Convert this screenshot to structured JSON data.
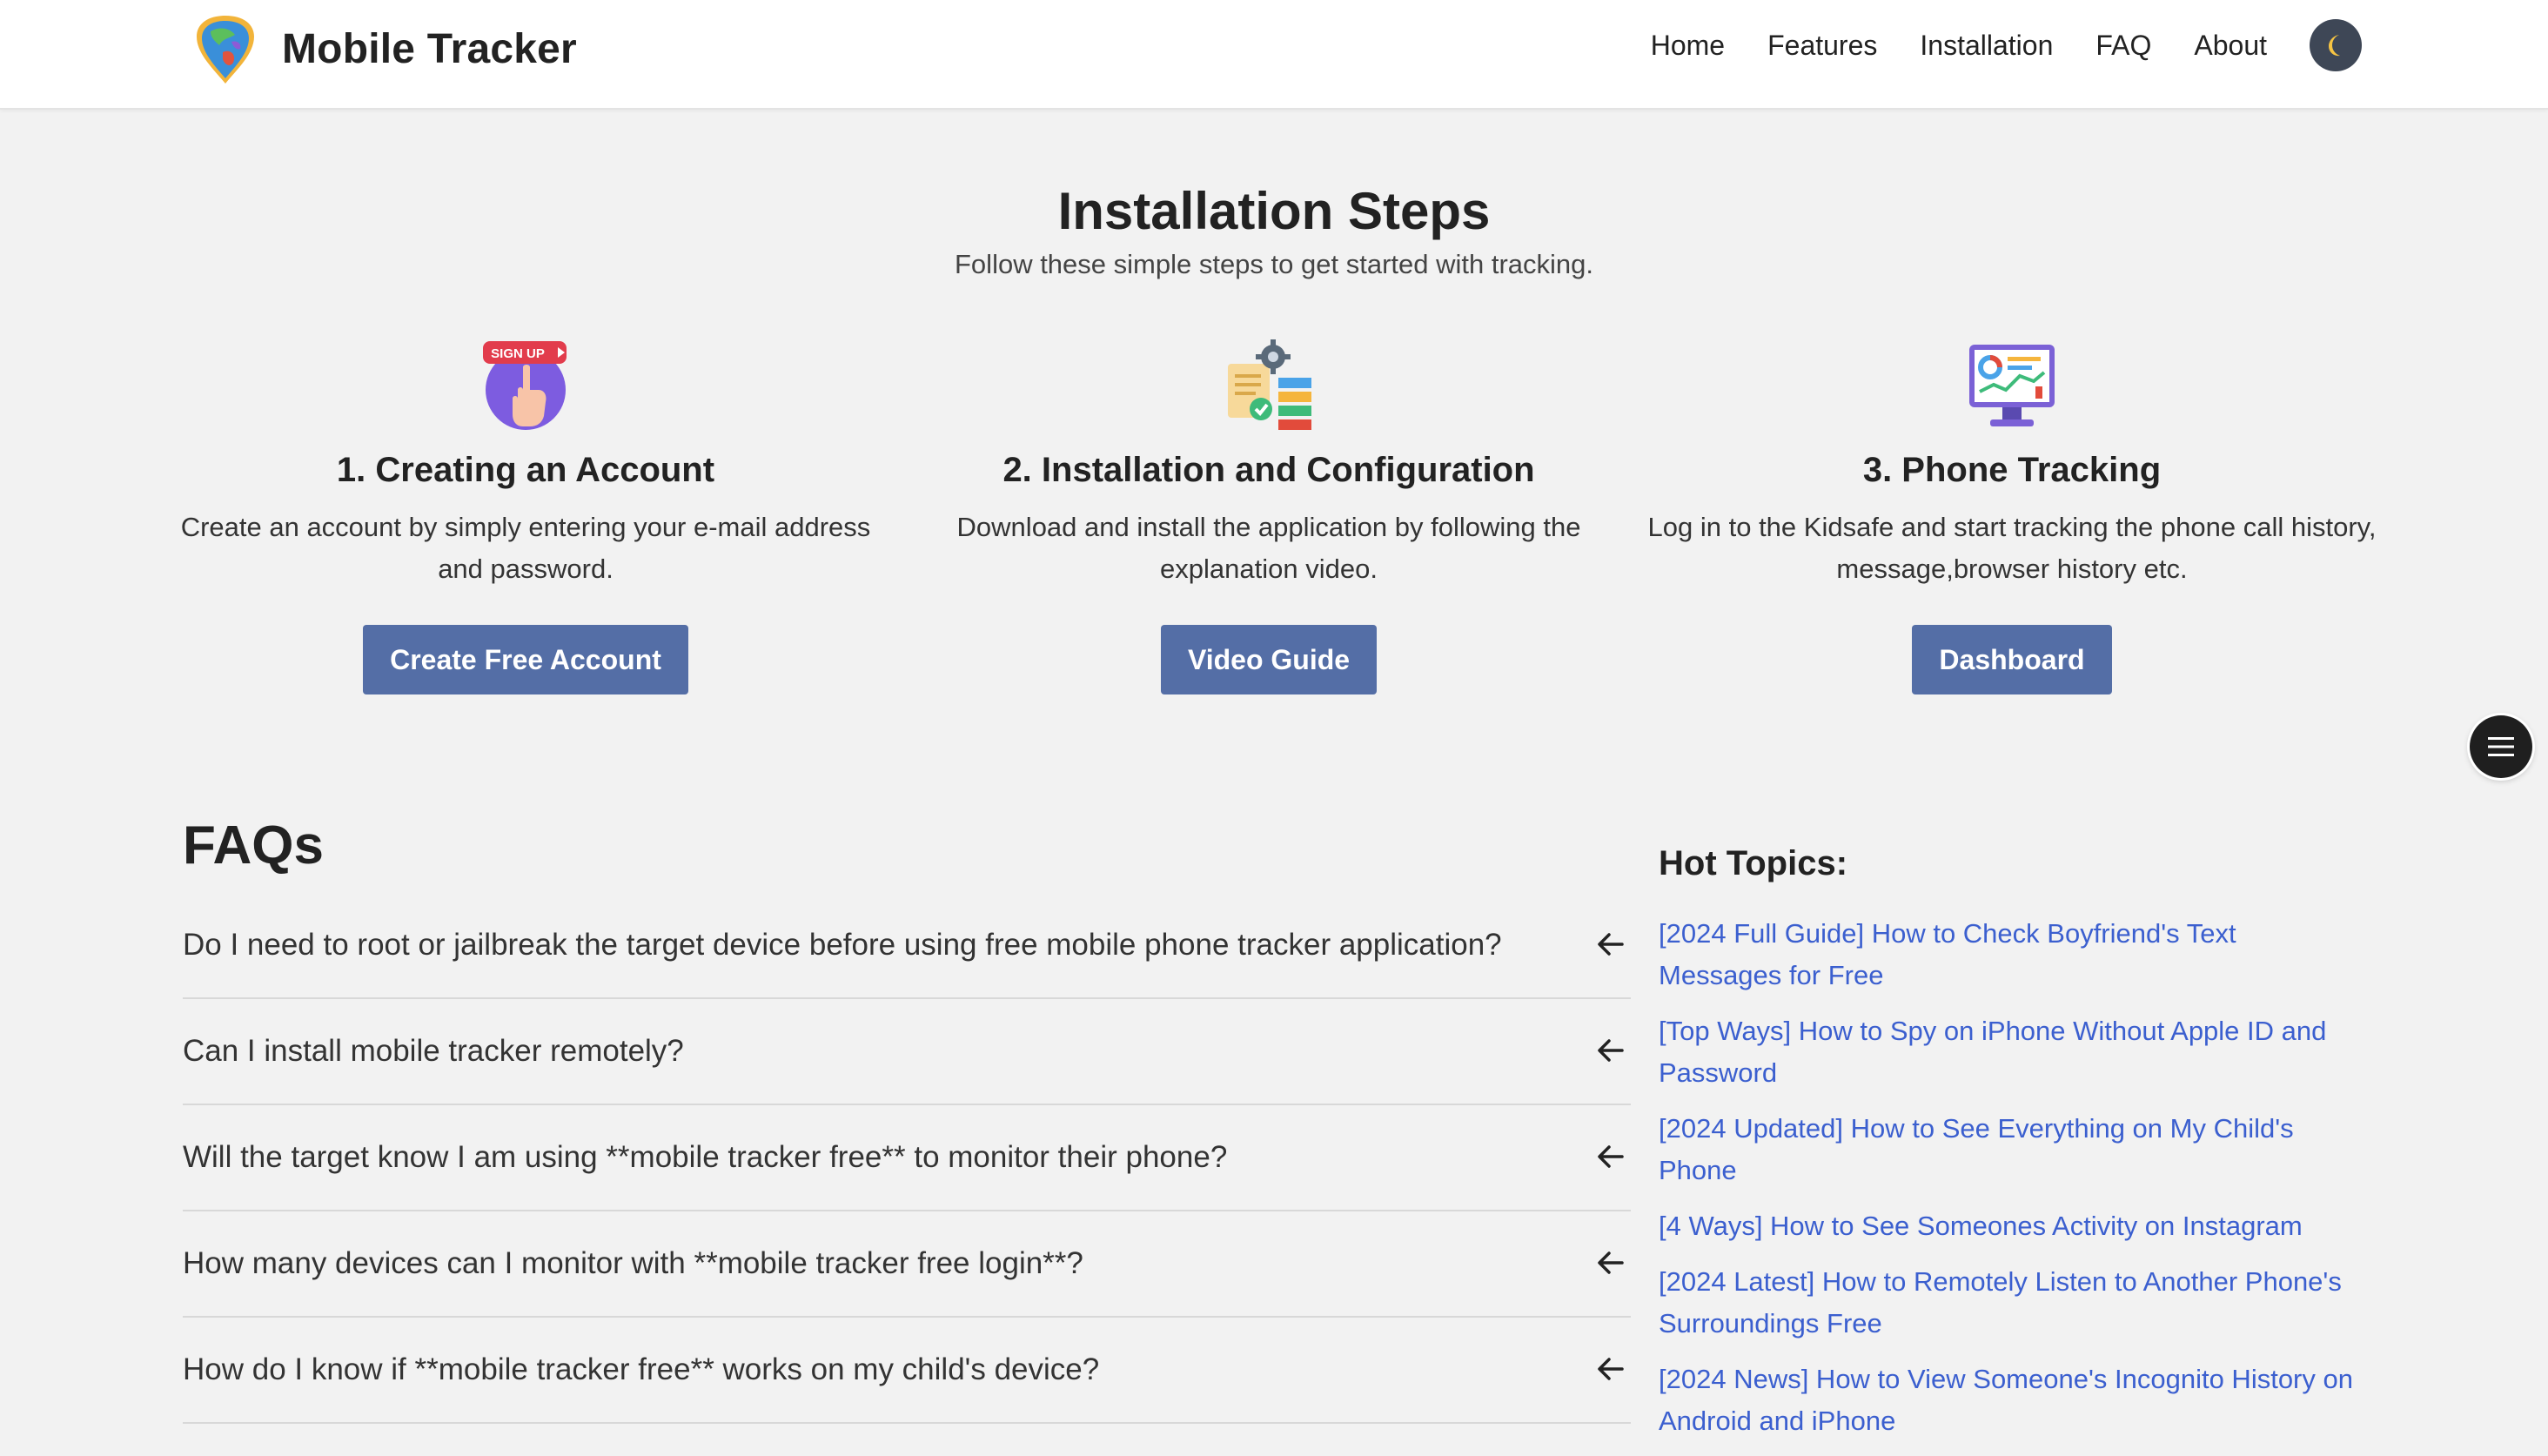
{
  "navbar": {
    "brand_name": "Mobile Tracker",
    "links": [
      "Home",
      "Features",
      "Installation",
      "FAQ",
      "About"
    ],
    "theme_toggle_icon": "moon-icon"
  },
  "installation": {
    "title": "Installation Steps",
    "subtitle": "Follow these simple steps to get started with tracking.",
    "steps": [
      {
        "icon": "sign-up-icon",
        "icon_label": "SIGN UP",
        "title": "1. Creating an Account",
        "description": "Create an account by simply entering your e-mail address and password.",
        "button": "Create Free Account"
      },
      {
        "icon": "configuration-icon",
        "title": "2. Installation and Configuration",
        "description": "Download and install the application by following the explanation video.",
        "button": "Video Guide"
      },
      {
        "icon": "monitor-tracking-icon",
        "title": "3. Phone Tracking",
        "description": "Log in to the Kidsafe and start tracking the phone call history, message,browser history etc.",
        "button": "Dashboard"
      }
    ]
  },
  "faq": {
    "title": "FAQs",
    "items": [
      "Do I need to root or jailbreak the target device before using free mobile phone tracker application?",
      "Can I install mobile tracker remotely?",
      "Will the target know I am using **mobile tracker free** to monitor their phone?",
      "How many devices can I monitor with **mobile tracker free login**?",
      "How do I know if **mobile tracker free** works on my child's device?"
    ]
  },
  "hot_topics": {
    "title": "Hot Topics:",
    "links": [
      "[2024 Full Guide] How to Check Boyfriend's Text Messages for Free",
      "[Top Ways] How to Spy on iPhone Without Apple ID and Password",
      "[2024 Updated] How to See Everything on My Child's Phone",
      "[4 Ways] How to See Someones Activity on Instagram",
      "[2024 Latest] How to Remotely Listen to Another Phone's Surroundings Free",
      "[2024 News] How to View Someone's Incognito History on Android and iPhone"
    ]
  },
  "floating_menu_icon": "menu-icon"
}
